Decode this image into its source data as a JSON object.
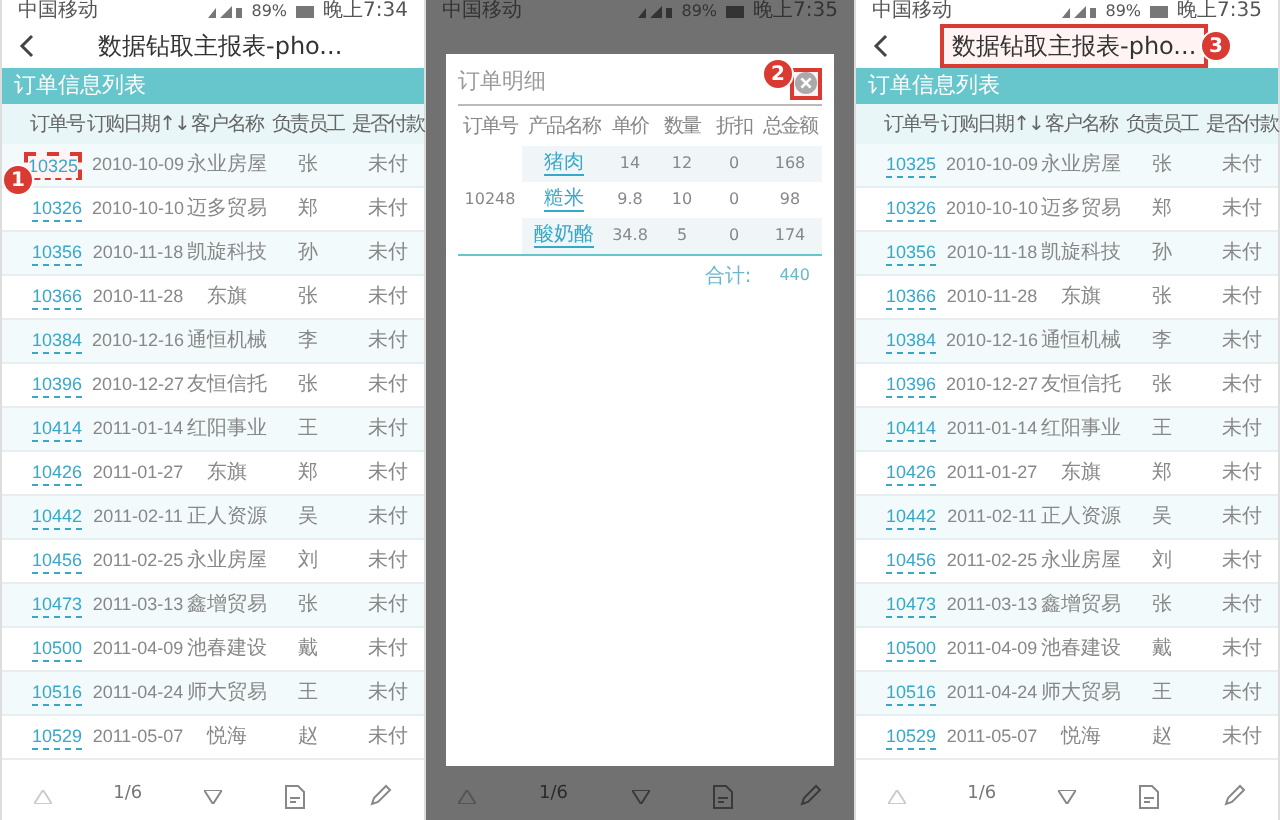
{
  "phones": [
    {
      "kind": "list",
      "status": {
        "carrier": "中国移动",
        "battery": "89%",
        "time": "晚上7:34"
      },
      "title": "数据钻取主报表-pho...",
      "section": "订单信息列表",
      "columns": [
        "订单号",
        "订购日期↑↓",
        "客户名称",
        "负责员工",
        "是否付款"
      ],
      "rows": [
        [
          "10325",
          "2010-10-09",
          "永业房屋",
          "张",
          "未付"
        ],
        [
          "10326",
          "2010-10-10",
          "迈多贸易",
          "郑",
          "未付"
        ],
        [
          "10356",
          "2010-11-18",
          "凯旋科技",
          "孙",
          "未付"
        ],
        [
          "10366",
          "2010-11-28",
          "东旗",
          "张",
          "未付"
        ],
        [
          "10384",
          "2010-12-16",
          "通恒机械",
          "李",
          "未付"
        ],
        [
          "10396",
          "2010-12-27",
          "友恒信托",
          "张",
          "未付"
        ],
        [
          "10414",
          "2011-01-14",
          "红阳事业",
          "王",
          "未付"
        ],
        [
          "10426",
          "2011-01-27",
          "东旗",
          "郑",
          "未付"
        ],
        [
          "10442",
          "2011-02-11",
          "正人资源",
          "吴",
          "未付"
        ],
        [
          "10456",
          "2011-02-25",
          "永业房屋",
          "刘",
          "未付"
        ],
        [
          "10473",
          "2011-03-13",
          "鑫增贸易",
          "张",
          "未付"
        ],
        [
          "10500",
          "2011-04-09",
          "池春建设",
          "戴",
          "未付"
        ],
        [
          "10516",
          "2011-04-24",
          "师大贸易",
          "王",
          "未付"
        ],
        [
          "10529",
          "2011-05-07",
          "悦海",
          "赵",
          "未付"
        ]
      ],
      "pager": "1/6",
      "callout": {
        "label": "1"
      },
      "order_highlighted": true,
      "title_highlighted": false
    },
    {
      "kind": "dialog",
      "status": {
        "carrier": "中国移动",
        "battery": "89%",
        "time": "晚上7:35"
      },
      "dialog": {
        "title": "订单明细",
        "close_highlighted": true,
        "columns": [
          "订单号",
          "产品名称",
          "单价",
          "数量",
          "折扣",
          "总金额"
        ],
        "rows": [
          [
            "",
            "猪肉",
            "14",
            "12",
            "0",
            "168"
          ],
          [
            "10248",
            "糙米",
            "9.8",
            "10",
            "0",
            "98"
          ],
          [
            "",
            "酸奶酪",
            "34.8",
            "5",
            "0",
            "174"
          ]
        ],
        "total_label": "合计:",
        "total": "440"
      },
      "pager": "1/6",
      "callout": {
        "label": "2"
      }
    },
    {
      "kind": "list",
      "status": {
        "carrier": "中国移动",
        "battery": "89%",
        "time": "晚上7:35"
      },
      "title": "数据钻取主报表-pho...",
      "section": "订单信息列表",
      "columns": [
        "订单号",
        "订购日期↑↓",
        "客户名称",
        "负责员工",
        "是否付款"
      ],
      "rows": [
        [
          "10325",
          "2010-10-09",
          "永业房屋",
          "张",
          "未付"
        ],
        [
          "10326",
          "2010-10-10",
          "迈多贸易",
          "郑",
          "未付"
        ],
        [
          "10356",
          "2010-11-18",
          "凯旋科技",
          "孙",
          "未付"
        ],
        [
          "10366",
          "2010-11-28",
          "东旗",
          "张",
          "未付"
        ],
        [
          "10384",
          "2010-12-16",
          "通恒机械",
          "李",
          "未付"
        ],
        [
          "10396",
          "2010-12-27",
          "友恒信托",
          "张",
          "未付"
        ],
        [
          "10414",
          "2011-01-14",
          "红阳事业",
          "王",
          "未付"
        ],
        [
          "10426",
          "2011-01-27",
          "东旗",
          "郑",
          "未付"
        ],
        [
          "10442",
          "2011-02-11",
          "正人资源",
          "吴",
          "未付"
        ],
        [
          "10456",
          "2011-02-25",
          "永业房屋",
          "刘",
          "未付"
        ],
        [
          "10473",
          "2011-03-13",
          "鑫增贸易",
          "张",
          "未付"
        ],
        [
          "10500",
          "2011-04-09",
          "池春建设",
          "戴",
          "未付"
        ],
        [
          "10516",
          "2011-04-24",
          "师大贸易",
          "王",
          "未付"
        ],
        [
          "10529",
          "2011-05-07",
          "悦海",
          "赵",
          "未付"
        ]
      ],
      "pager": "1/6",
      "callout": {
        "label": "3"
      },
      "order_highlighted": false,
      "title_highlighted": true
    }
  ]
}
